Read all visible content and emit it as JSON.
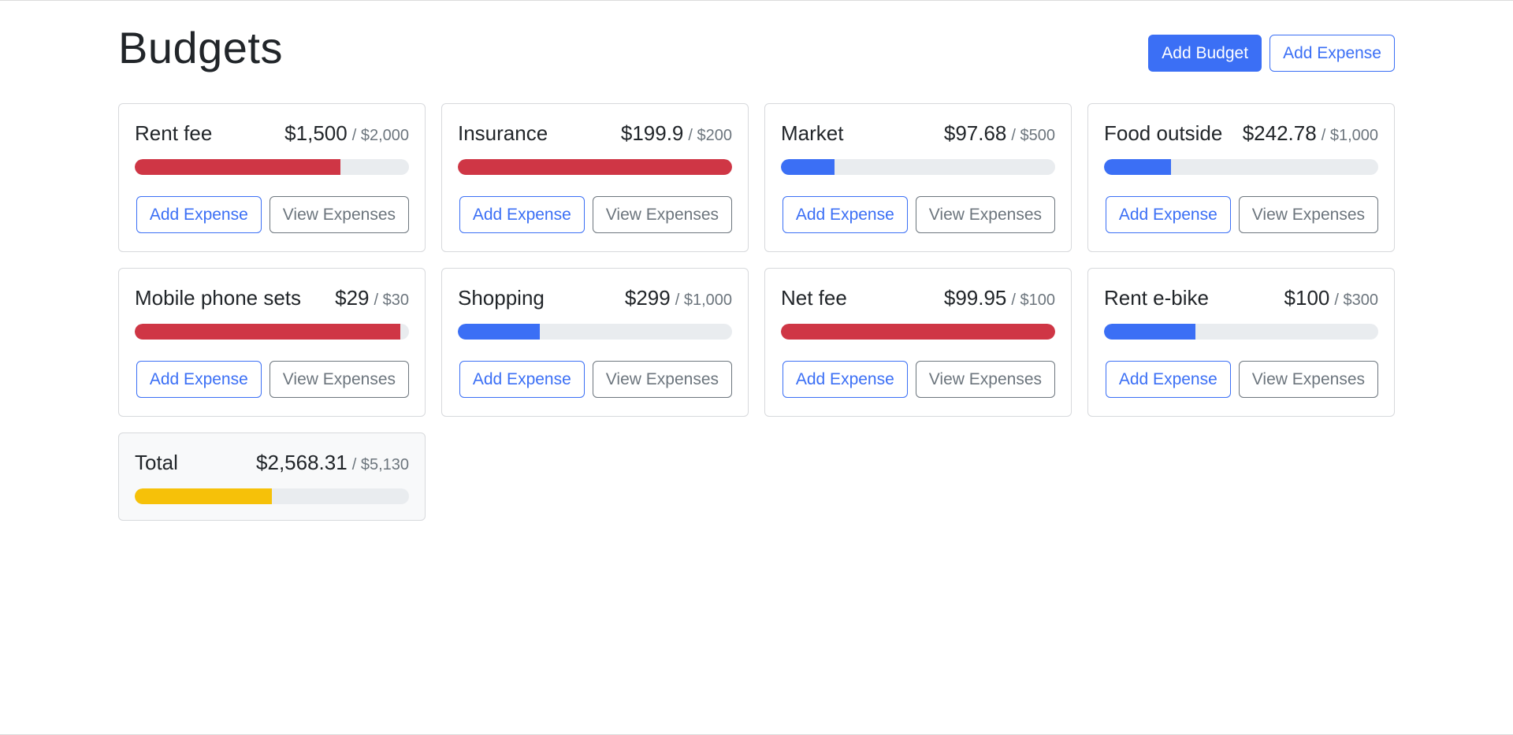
{
  "page": {
    "title": "Budgets",
    "add_budget_label": "Add Budget",
    "add_expense_label": "Add Expense"
  },
  "card_buttons": {
    "add_expense": "Add Expense",
    "view_expenses": "View Expenses"
  },
  "colors": {
    "primary": "#3b6ff5",
    "danger": "#cf3645",
    "warning": "#f6c109",
    "track": "#e9ecef"
  },
  "budgets": [
    {
      "name": "Rent fee",
      "spent": "$1,500",
      "max": "/ $2,000",
      "progress": 0.75,
      "color": "red"
    },
    {
      "name": "Insurance",
      "spent": "$199.9",
      "max": "/ $200",
      "progress": 1.0,
      "color": "red"
    },
    {
      "name": "Market",
      "spent": "$97.68",
      "max": "/ $500",
      "progress": 0.195,
      "color": "blue"
    },
    {
      "name": "Food outside",
      "spent": "$242.78",
      "max": "/ $1,000",
      "progress": 0.243,
      "color": "blue"
    },
    {
      "name": "Mobile phone sets",
      "spent": "$29",
      "max": "/ $30",
      "progress": 0.967,
      "color": "red"
    },
    {
      "name": "Shopping",
      "spent": "$299",
      "max": "/ $1,000",
      "progress": 0.299,
      "color": "blue"
    },
    {
      "name": "Net fee",
      "spent": "$99.95",
      "max": "/ $100",
      "progress": 1.0,
      "color": "red"
    },
    {
      "name": "Rent e-bike",
      "spent": "$100",
      "max": "/ $300",
      "progress": 0.333,
      "color": "blue"
    }
  ],
  "total": {
    "name": "Total",
    "spent": "$2,568.31",
    "max": "/ $5,130",
    "progress": 0.5,
    "color": "yellow"
  }
}
